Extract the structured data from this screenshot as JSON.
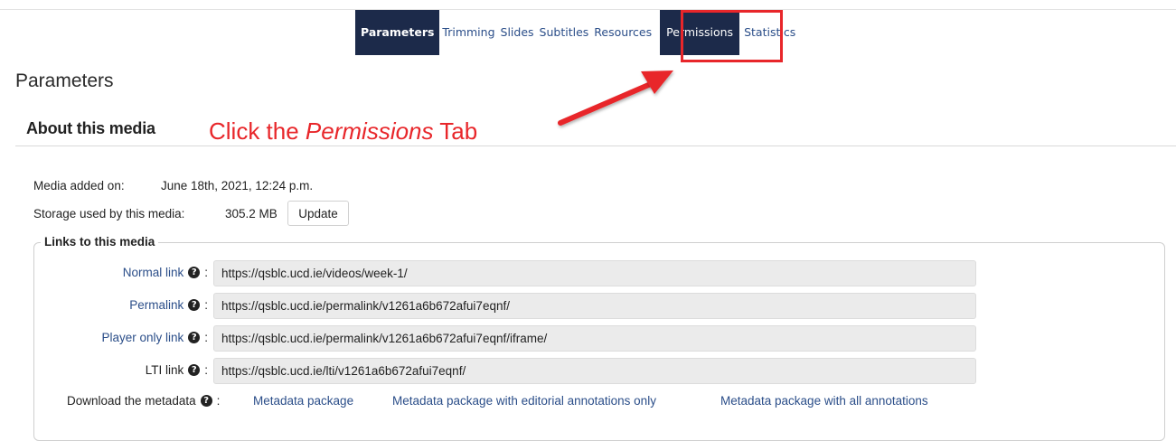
{
  "tabs": [
    {
      "label": "Parameters",
      "active": true
    },
    {
      "label": "Trimming"
    },
    {
      "label": "Slides"
    },
    {
      "label": "Subtitles"
    },
    {
      "label": "Resources"
    },
    {
      "label": "Permissions"
    },
    {
      "label": "Statistics"
    }
  ],
  "page_title": "Parameters",
  "section_title": "About this media",
  "callout": {
    "before": "Click the ",
    "emphasis": "Permissions",
    "after": " Tab",
    "color": "#e8262a"
  },
  "media_info": {
    "added_label": "Media added on:",
    "added_value": "June 18th, 2021, 12:24 p.m.",
    "storage_label": "Storage used by this media:",
    "storage_value": "305.2 MB",
    "update_button": "Update"
  },
  "links": {
    "legend": "Links to this media",
    "help_icon": "?",
    "colon": ":",
    "items": [
      {
        "label": "Normal link",
        "value": "https://qsblc.ucd.ie/videos/week-1/"
      },
      {
        "label": "Permalink",
        "value": "https://qsblc.ucd.ie/permalink/v1261a6b672afui7eqnf/"
      },
      {
        "label": "Player only link",
        "value": "https://qsblc.ucd.ie/permalink/v1261a6b672afui7eqnf/iframe/"
      },
      {
        "label": "LTI link",
        "value": "https://qsblc.ucd.ie/lti/v1261a6b672afui7eqnf/"
      }
    ]
  },
  "download": {
    "label": "Download the metadata",
    "links": [
      "Metadata package",
      "Metadata package with editorial annotations only",
      "Metadata package with all annotations"
    ]
  },
  "colors": {
    "nav_active": "#1c2a4a",
    "link": "#2b4e89",
    "annotation": "#e8262a"
  }
}
